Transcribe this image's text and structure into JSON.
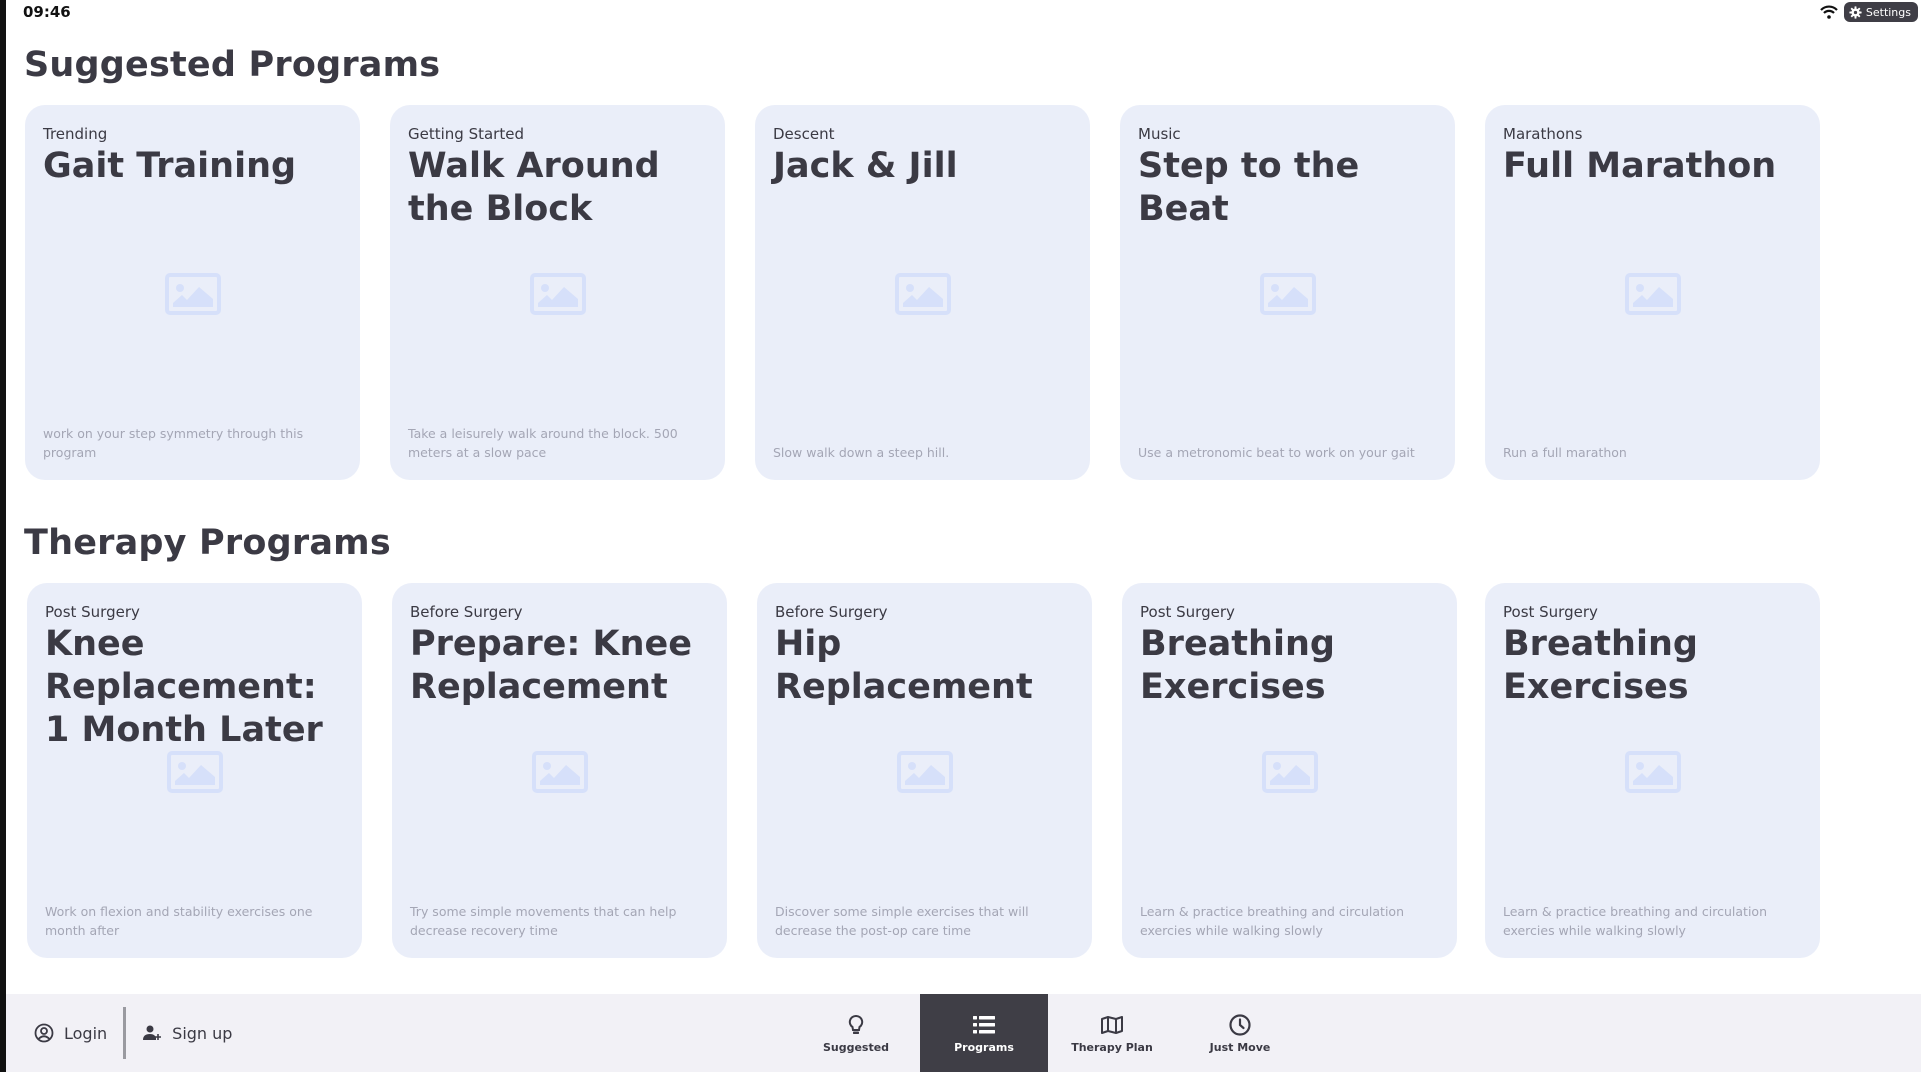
{
  "status_bar": {
    "time": "09:46",
    "wifi_icon": "wifi-icon",
    "settings_label": "Settings",
    "settings_icon": "gear-icon"
  },
  "sections": {
    "suggested": {
      "title": "Suggested Programs",
      "cards": [
        {
          "category": "Trending",
          "title": "Gait Training",
          "description": "work on your step symmetry through this program",
          "image_icon": "image-placeholder-icon"
        },
        {
          "category": "Getting Started",
          "title": "Walk Around the Block",
          "description": "Take a leisurely walk around the block. 500 meters at a slow pace",
          "image_icon": "image-placeholder-icon"
        },
        {
          "category": "Descent",
          "title": "Jack & Jill",
          "description": "Slow walk down a steep hill.",
          "image_icon": "image-placeholder-icon"
        },
        {
          "category": "Music",
          "title": "Step to the Beat",
          "description": "Use a metronomic beat to work on your gait",
          "image_icon": "image-placeholder-icon"
        },
        {
          "category": "Marathons",
          "title": "Full Marathon",
          "description": "Run a full marathon",
          "image_icon": "image-placeholder-icon"
        }
      ]
    },
    "therapy": {
      "title": "Therapy Programs",
      "cards": [
        {
          "category": "Post Surgery",
          "title": "Knee Replacement: 1 Month Later",
          "description": "Work on flexion and stability exercises one month after",
          "image_icon": "image-placeholder-icon"
        },
        {
          "category": "Before Surgery",
          "title": "Prepare: Knee Replacement",
          "description": "Try some simple movements that can help decrease recovery time",
          "image_icon": "image-placeholder-icon"
        },
        {
          "category": "Before Surgery",
          "title": "Hip Replacement",
          "description": "Discover some simple exercises that will decrease the post-op care time",
          "image_icon": "image-placeholder-icon"
        },
        {
          "category": "Post Surgery",
          "title": "Breathing Exercises",
          "description": "Learn & practice breathing and circulation exercies while walking slowly",
          "image_icon": "image-placeholder-icon"
        },
        {
          "category": "Post Surgery",
          "title": "Breathing Exercises",
          "description": "Learn & practice breathing and circulation exercies while walking slowly",
          "image_icon": "image-placeholder-icon"
        }
      ]
    }
  },
  "bottom_bar": {
    "login_label": "Login",
    "login_icon": "user-circle-icon",
    "signup_label": "Sign up",
    "signup_icon": "user-plus-icon",
    "nav": [
      {
        "label": "Suggested",
        "icon": "lightbulb-icon",
        "active": false
      },
      {
        "label": "Programs",
        "icon": "list-icon",
        "active": true
      },
      {
        "label": "Therapy Plan",
        "icon": "map-icon",
        "active": false
      },
      {
        "label": "Just Move",
        "icon": "clock-icon",
        "active": false
      }
    ]
  },
  "colors": {
    "card_bg": "#eaeef9",
    "text_primary": "#3b3a44",
    "text_muted": "#a4a6b5",
    "nav_bg": "#f2f1f6",
    "nav_active_bg": "#3f3e46",
    "placeholder_icon": "#d6e0fa"
  }
}
